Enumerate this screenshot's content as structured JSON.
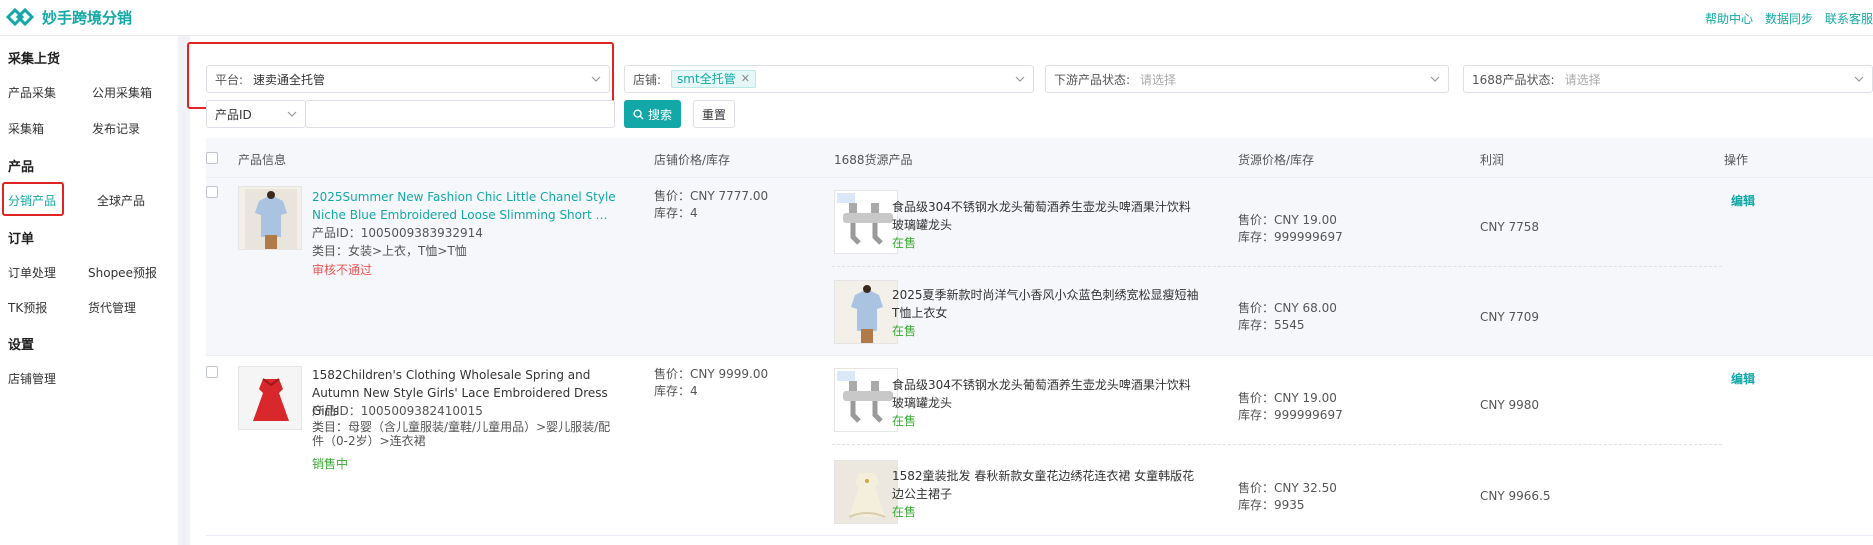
{
  "app": {
    "title": "妙手跨境分销"
  },
  "top_links": [
    "帮助中心",
    "数据同步",
    "联系客服"
  ],
  "sidebar": {
    "sections": [
      {
        "title": "采集上货",
        "items": [
          "产品采集",
          "公用采集箱",
          "采集箱",
          "发布记录"
        ]
      },
      {
        "title": "产品",
        "items": [
          "分销产品",
          "全球产品"
        ]
      },
      {
        "title": "订单",
        "items": [
          "订单处理",
          "Shopee预报",
          "TK预报",
          "货代管理"
        ]
      },
      {
        "title": "设置",
        "items": [
          "店铺管理"
        ]
      }
    ],
    "active_item": "分销产品"
  },
  "filters": {
    "platform": {
      "label": "平台:",
      "value": "速卖通全托管"
    },
    "store": {
      "label": "店铺:",
      "tag": "smt全托管"
    },
    "downstream_status": {
      "label": "下游产品状态:",
      "placeholder": "请选择"
    },
    "status_1688": {
      "label": "1688产品状态:",
      "placeholder": "请选择"
    },
    "id_type": {
      "value": "产品ID"
    },
    "search_button": "搜索",
    "reset_button": "重置"
  },
  "table": {
    "headers": [
      "产品信息",
      "店铺价格/库存",
      "1688货源产品",
      "货源价格/库存",
      "利润",
      "操作"
    ],
    "rows": [
      {
        "name": "2025Summer New Fashion Chic Little Chanel Style Niche Blue Embroidered Loose Slimming Short …",
        "product_id": "产品ID：1005009383932914",
        "category": "类目：女装>上衣，T恤>T恤",
        "status": "审核不通过",
        "shop_price": "售价：CNY 7777.00",
        "shop_stock": "库存：4",
        "edit": "编辑",
        "sources": [
          {
            "name": "食品级304不锈钢水龙头葡萄酒养生壶龙头啤酒果汁饮料玻璃罐龙头",
            "status": "在售",
            "price": "售价：CNY 19.00",
            "stock": "库存：999999697",
            "profit": "CNY 7758"
          },
          {
            "name": "2025夏季新款时尚洋气小香风小众蓝色刺绣宽松显瘦短袖T恤上衣女",
            "status": "在售",
            "price": "售价：CNY 68.00",
            "stock": "库存：5545",
            "profit": "CNY 7709"
          }
        ]
      },
      {
        "name": "1582Children's Clothing Wholesale Spring and Autumn New Style Girls' Lace Embroidered Dress Girls",
        "product_id": "产品ID：1005009382410015",
        "category": "类目：母婴（含儿童服装/童鞋/儿童用品）>婴儿服装/配件（0-2岁）>连衣裙",
        "status": "销售中",
        "shop_price": "售价：CNY 9999.00",
        "shop_stock": "库存：4",
        "edit": "编辑",
        "sources": [
          {
            "name": "食品级304不锈钢水龙头葡萄酒养生壶龙头啤酒果汁饮料玻璃罐龙头",
            "status": "在售",
            "price": "售价：CNY 19.00",
            "stock": "库存：999999697",
            "profit": "CNY 9980"
          },
          {
            "name": "1582童装批发 春秋新款女童花边绣花连衣裙 女童韩版花边公主裙子",
            "status": "在售",
            "price": "售价：CNY 32.50",
            "stock": "库存：9935",
            "profit": "CNY 9966.5"
          }
        ]
      }
    ]
  },
  "colors": {
    "accent": "#13a8a8",
    "error": "#e55555",
    "success": "#3aa935",
    "highlight_box": "#e02424"
  }
}
